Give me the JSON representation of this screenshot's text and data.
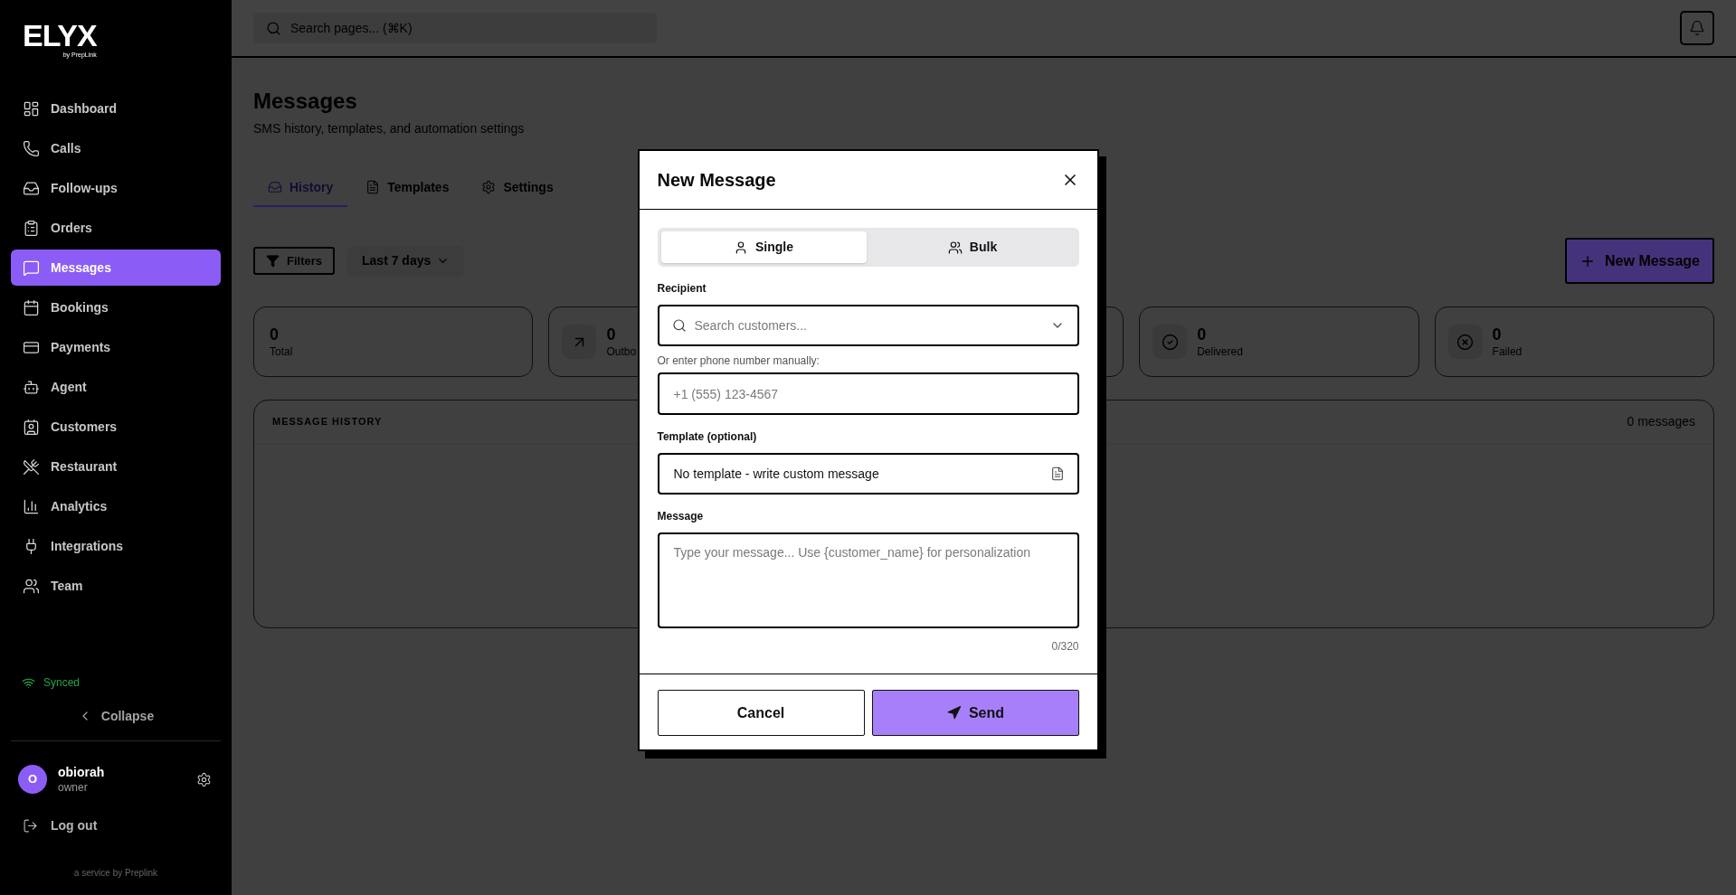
{
  "sidebar": {
    "logo": {
      "wordmark": "ELYX",
      "tagline": "by PrepLink"
    },
    "nav": [
      {
        "label": "Dashboard",
        "selected": false
      },
      {
        "label": "Calls",
        "selected": false
      },
      {
        "label": "Follow-ups",
        "selected": false
      },
      {
        "label": "Orders",
        "selected": false
      },
      {
        "label": "Messages",
        "selected": true
      },
      {
        "label": "Bookings",
        "selected": false
      },
      {
        "label": "Payments",
        "selected": false
      },
      {
        "label": "Agent",
        "selected": false
      },
      {
        "label": "Customers",
        "selected": false
      },
      {
        "label": "Restaurant",
        "selected": false
      },
      {
        "label": "Analytics",
        "selected": false
      },
      {
        "label": "Integrations",
        "selected": false
      },
      {
        "label": "Team",
        "selected": false
      }
    ],
    "sync_status": "Synced",
    "collapse": "Collapse",
    "user": {
      "initial": "O",
      "name": "obiorah",
      "role": "owner"
    },
    "logout": "Log out",
    "footer": "a service by Preplink"
  },
  "header": {
    "search": {
      "placeholder": "Search pages... (⌘K)"
    }
  },
  "page": {
    "title": "Messages",
    "subtitle": "SMS history, templates, and automation settings",
    "tabs": [
      {
        "label": "History",
        "selected": true
      },
      {
        "label": "Templates",
        "selected": false
      },
      {
        "label": "Settings",
        "selected": false
      }
    ],
    "filters_button": "Filters",
    "date_range": "Last 7 days",
    "new_message_button": "New Message",
    "stats": [
      {
        "kind": "plain",
        "value": "0",
        "label": "Total"
      },
      {
        "kind": "icon",
        "value": "0",
        "label": "Outbo"
      },
      {
        "kind": "covered"
      },
      {
        "kind": "icon",
        "value": "0",
        "label": "Delivered"
      },
      {
        "kind": "icon",
        "value": "0",
        "label": "Failed"
      }
    ],
    "history": {
      "title": "MESSAGE HISTORY",
      "count": "0 messages"
    }
  },
  "modal": {
    "title": "New Message",
    "modes": [
      {
        "label": "Single",
        "selected": true
      },
      {
        "label": "Bulk",
        "selected": false
      }
    ],
    "recipient": {
      "label": "Recipient",
      "placeholder": "Search customers..."
    },
    "phone": {
      "label": "Or enter phone number manually:",
      "placeholder": "+1 (555) 123-4567"
    },
    "template": {
      "label": "Template (optional)",
      "value": "No template - write custom message"
    },
    "message": {
      "label": "Message",
      "placeholder": "Type your message... Use {customer_name} for personalization",
      "counter": "0/320"
    },
    "buttons": {
      "cancel": "Cancel",
      "send": "Send"
    }
  }
}
